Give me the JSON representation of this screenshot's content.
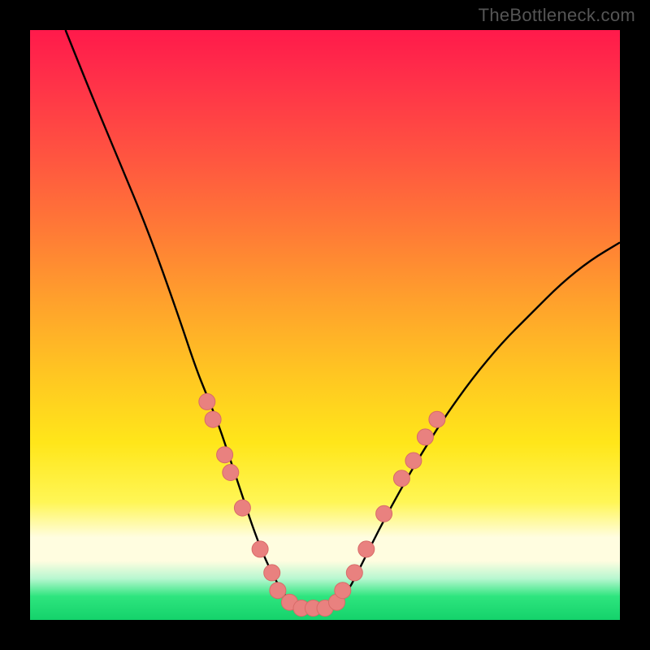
{
  "watermark": "TheBottleneck.com",
  "colors": {
    "background": "#000000",
    "curve_stroke": "#000000",
    "marker_fill": "#e9817f",
    "marker_stroke": "#d86b68",
    "gradient_top": "#ff1a4b",
    "gradient_bottom": "#14d26b"
  },
  "chart_data": {
    "type": "line",
    "title": "",
    "xlabel": "",
    "ylabel": "",
    "xlim": [
      0,
      100
    ],
    "ylim": [
      0,
      100
    ],
    "grid": false,
    "series": [
      {
        "name": "bottleneck-curve",
        "x": [
          6,
          10,
          15,
          20,
          25,
          28,
          30,
          32,
          34,
          36,
          38,
          40,
          42,
          44,
          46,
          48,
          50,
          52,
          54,
          56,
          60,
          65,
          70,
          75,
          80,
          85,
          90,
          95,
          100
        ],
        "y": [
          100,
          90,
          78,
          66,
          52,
          43,
          38,
          33,
          27,
          21,
          15,
          10,
          6,
          3,
          2,
          2,
          2,
          3,
          5,
          9,
          17,
          26,
          34,
          41,
          47,
          52,
          57,
          61,
          64
        ]
      }
    ],
    "markers": [
      {
        "x": 30,
        "y": 37
      },
      {
        "x": 31,
        "y": 34
      },
      {
        "x": 33,
        "y": 28
      },
      {
        "x": 34,
        "y": 25
      },
      {
        "x": 36,
        "y": 19
      },
      {
        "x": 39,
        "y": 12
      },
      {
        "x": 41,
        "y": 8
      },
      {
        "x": 42,
        "y": 5
      },
      {
        "x": 44,
        "y": 3
      },
      {
        "x": 46,
        "y": 2
      },
      {
        "x": 48,
        "y": 2
      },
      {
        "x": 50,
        "y": 2
      },
      {
        "x": 52,
        "y": 3
      },
      {
        "x": 53,
        "y": 5
      },
      {
        "x": 55,
        "y": 8
      },
      {
        "x": 57,
        "y": 12
      },
      {
        "x": 60,
        "y": 18
      },
      {
        "x": 63,
        "y": 24
      },
      {
        "x": 65,
        "y": 27
      },
      {
        "x": 67,
        "y": 31
      },
      {
        "x": 69,
        "y": 34
      }
    ]
  }
}
